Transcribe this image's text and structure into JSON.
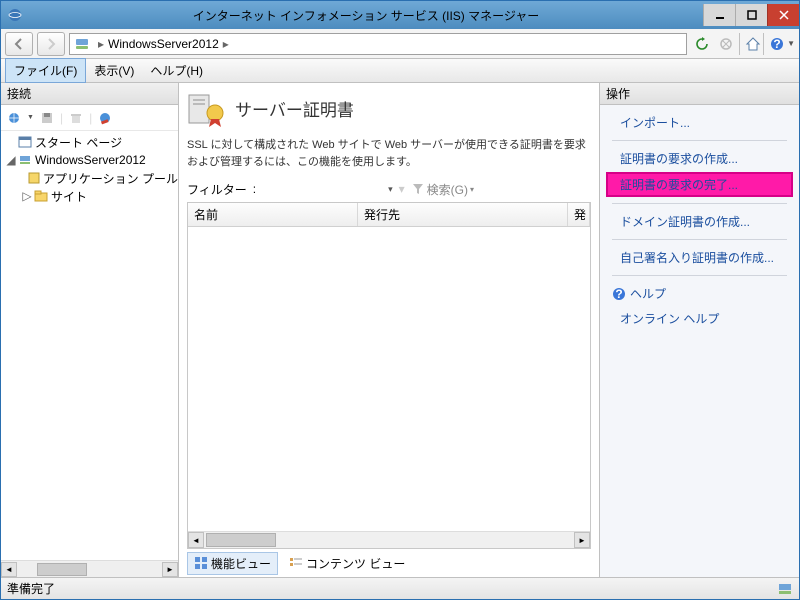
{
  "window": {
    "title": "インターネット インフォメーション サービス (IIS) マネージャー"
  },
  "breadcrumb": {
    "server": "WindowsServer2012"
  },
  "menu": {
    "file": "ファイル(F)",
    "view": "表示(V)",
    "help": "ヘルプ(H)"
  },
  "left": {
    "header": "接続",
    "tree": {
      "start": "スタート ページ",
      "server": "WindowsServer2012",
      "apppools": "アプリケーション プール",
      "sites": "サイト"
    }
  },
  "center": {
    "title": "サーバー証明書",
    "desc": "SSL に対して構成された Web サイトで Web サーバーが使用できる証明書を要求および管理するには、この機能を使用します。",
    "filterLabel": "フィルター",
    "searchLabel": "検索(G)",
    "columns": {
      "name": "名前",
      "issuer": "発行先",
      "exp": "発"
    },
    "views": {
      "feature": "機能ビュー",
      "content": "コンテンツ ビュー"
    }
  },
  "right": {
    "header": "操作",
    "actions": {
      "import": "インポート...",
      "createReq": "証明書の要求の作成...",
      "completeReq": "証明書の要求の完了...",
      "createDomain": "ドメイン証明書の作成...",
      "createSelf": "自己署名入り証明書の作成...",
      "help": "ヘルプ",
      "onlineHelp": "オンライン ヘルプ"
    }
  },
  "status": {
    "ready": "準備完了"
  }
}
